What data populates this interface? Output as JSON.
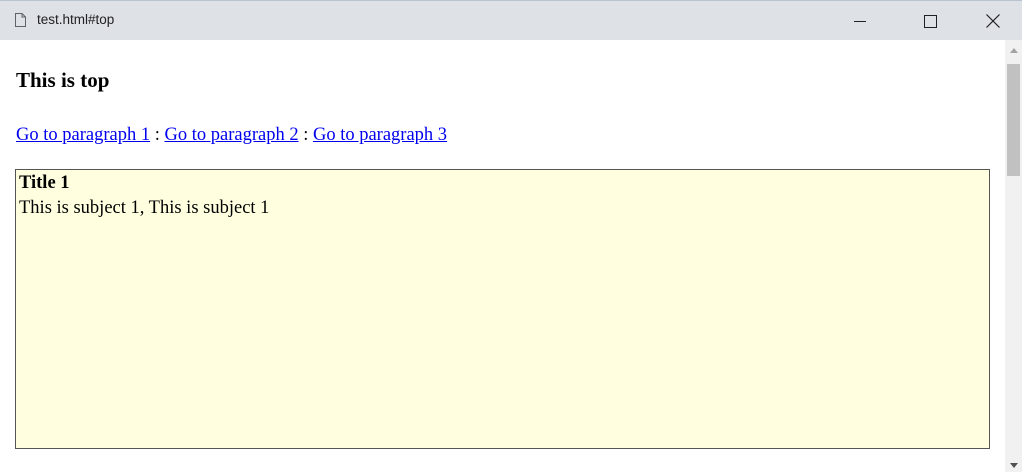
{
  "window": {
    "tab_title": "test.html#top",
    "icons": {
      "page": "document-icon",
      "minimize": "minimize-icon",
      "maximize": "maximize-icon",
      "close": "close-icon"
    }
  },
  "page": {
    "heading": "This is top",
    "links": [
      {
        "label": "Go to paragraph 1"
      },
      {
        "label": "Go to paragraph 2"
      },
      {
        "label": "Go to paragraph 3"
      }
    ],
    "separator": " : ",
    "paragraph": {
      "title": "Title 1",
      "body": "This is subject 1, This is subject 1",
      "background": "#ffffe0"
    }
  },
  "colors": {
    "titlebar_bg": "#dee1e6",
    "link": "#0000ee",
    "scroll_thumb": "#c1c1c1"
  }
}
